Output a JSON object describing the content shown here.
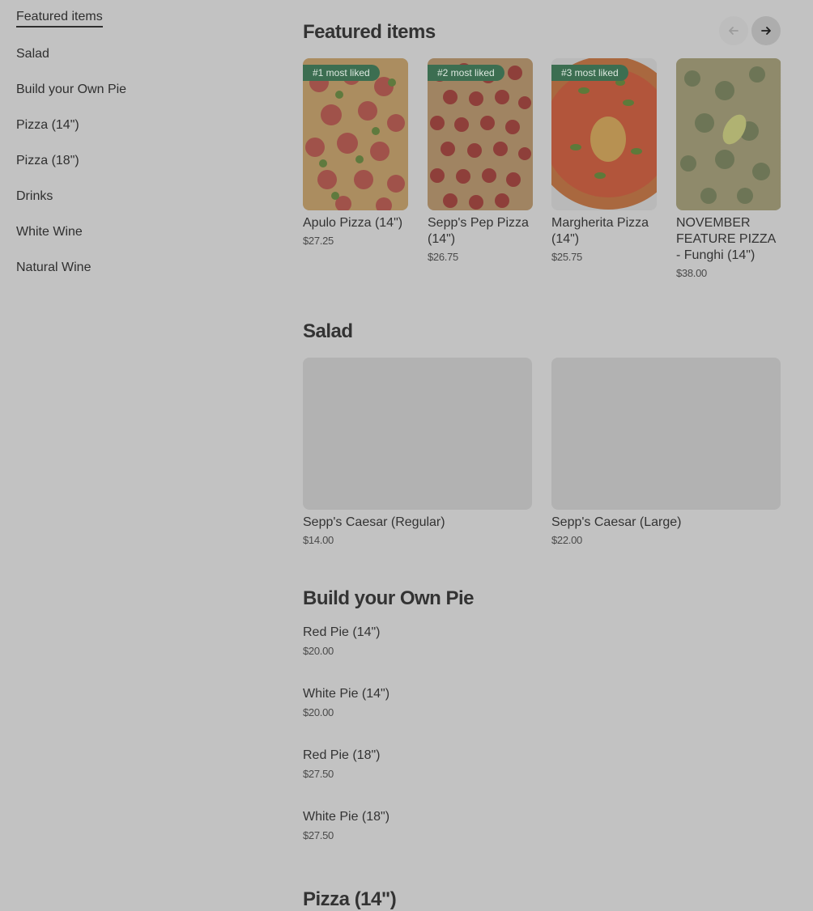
{
  "sidebar": {
    "items": [
      {
        "label": "Featured items"
      },
      {
        "label": "Salad"
      },
      {
        "label": "Build your Own Pie"
      },
      {
        "label": "Pizza (14\")"
      },
      {
        "label": "Pizza (18\")"
      },
      {
        "label": "Drinks"
      },
      {
        "label": "White Wine"
      },
      {
        "label": "Natural Wine"
      }
    ]
  },
  "featured": {
    "title": "Featured items",
    "prev_icon": "arrow-left-icon",
    "next_icon": "arrow-right-icon",
    "items": [
      {
        "badge": "#1 most liked",
        "name": "Apulo Pizza (14\")",
        "price": "$27.25"
      },
      {
        "badge": "#2 most liked",
        "name": "Sepp's Pep Pizza (14\")",
        "price": "$26.75"
      },
      {
        "badge": "#3 most liked",
        "name": "Margherita Pizza (14\")",
        "price": "$25.75"
      },
      {
        "badge": "",
        "name": "NOVEMBER FEATURE PIZZA - Funghi (14\")",
        "price": "$38.00"
      }
    ]
  },
  "salad": {
    "title": "Salad",
    "items": [
      {
        "name": "Sepp's Caesar (Regular)",
        "price": "$14.00"
      },
      {
        "name": "Sepp's Caesar (Large)",
        "price": "$22.00"
      }
    ]
  },
  "build_pie": {
    "title": "Build your Own Pie",
    "items": [
      {
        "name": "Red Pie (14\")",
        "price": "$20.00"
      },
      {
        "name": "White Pie (14\")",
        "price": "$20.00"
      },
      {
        "name": "Red Pie (18\")",
        "price": "$27.50"
      },
      {
        "name": "White Pie (18\")",
        "price": "$27.50"
      }
    ]
  },
  "pizza14": {
    "title": "Pizza (14\")"
  }
}
